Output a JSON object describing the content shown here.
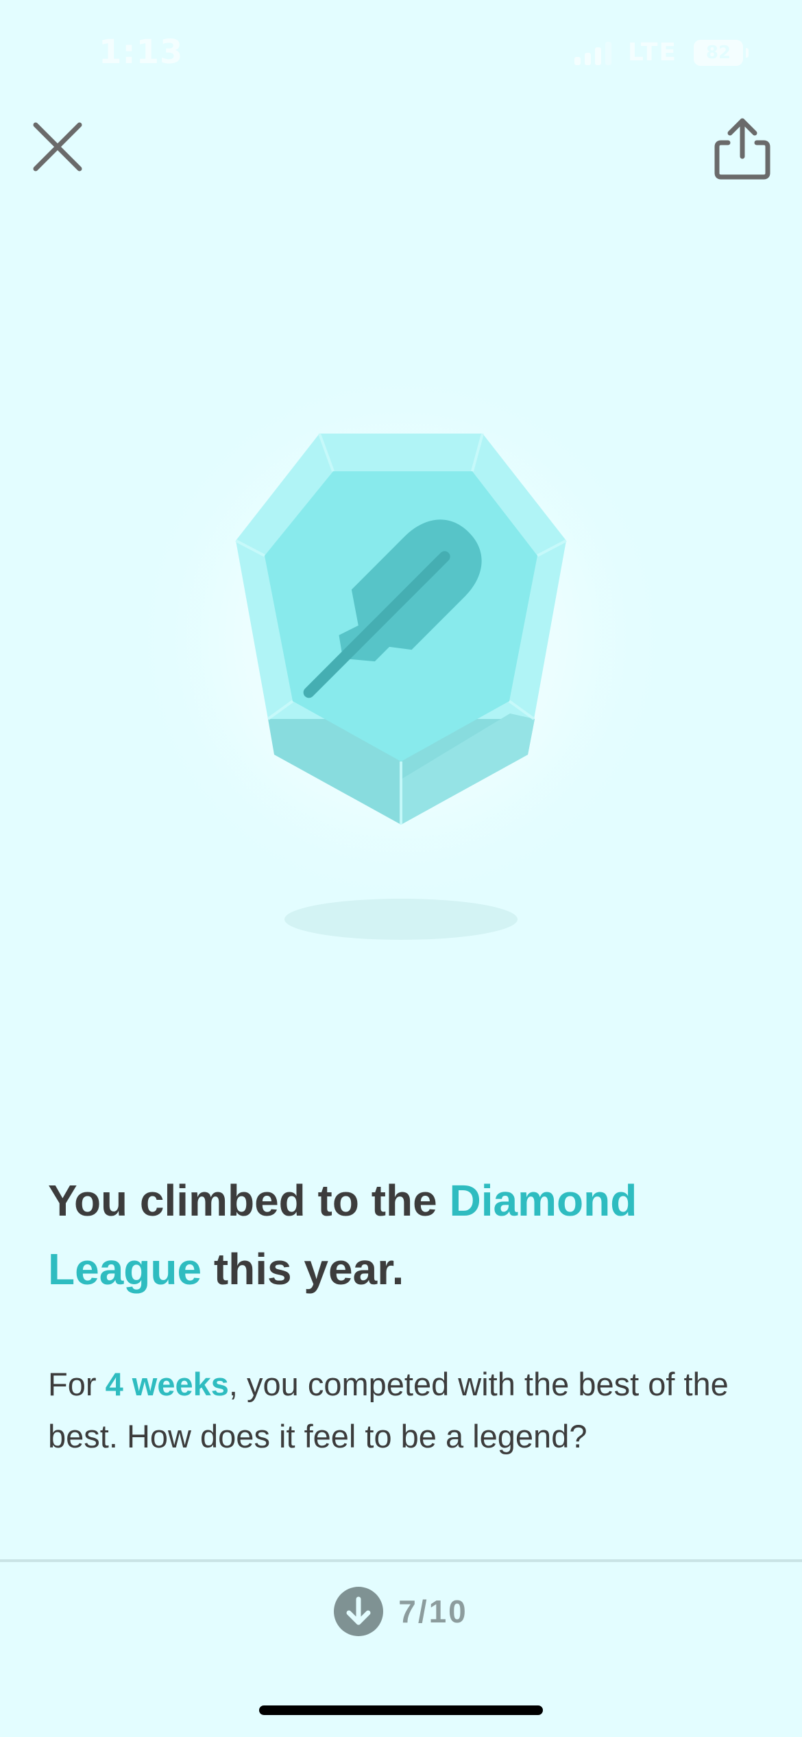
{
  "status_bar": {
    "time": "1:13",
    "network": "LTE",
    "battery": "82"
  },
  "toolbar": {
    "close_icon": "close-icon",
    "share_icon": "share-icon"
  },
  "hero": {
    "badge_icon": "diamond-league-feather-badge"
  },
  "headline": {
    "part1": "You climbed to the ",
    "highlight": "Diamond League",
    "part2": " this year."
  },
  "subtext": {
    "part1": "For ",
    "highlight": "4 weeks",
    "part2": ", you competed with the best of the best. How does it feel to be a legend?"
  },
  "pager": {
    "icon": "arrow-down-icon",
    "label": "7/10"
  },
  "colors": {
    "background": "#e3fdff",
    "accent": "#2ebcc0",
    "text": "#3c3c3c"
  }
}
